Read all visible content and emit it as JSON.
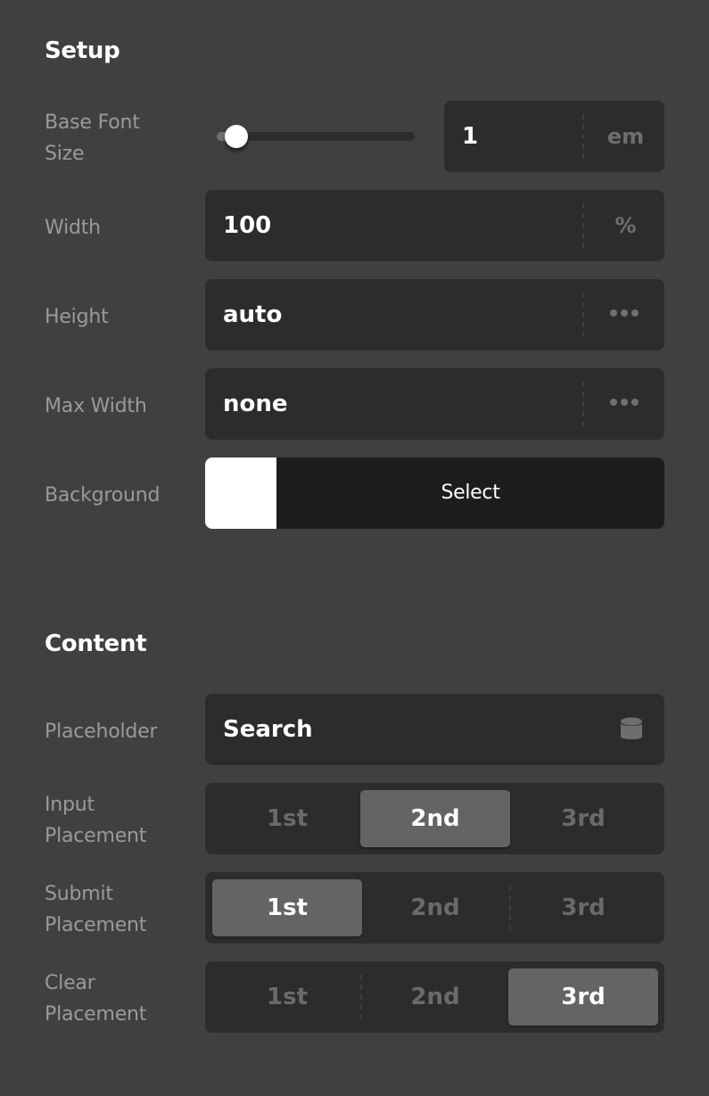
{
  "setup": {
    "title": "Setup",
    "base_font_size": {
      "label_line1": "Base Font",
      "label_line2": "Size",
      "slider_fraction": 0.1,
      "value": "1",
      "unit": "em"
    },
    "width": {
      "label": "Width",
      "value": "100",
      "unit": "%"
    },
    "height": {
      "label": "Height",
      "value": "auto",
      "unit_icon": "more-dots-icon"
    },
    "max_width": {
      "label": "Max Width",
      "value": "none",
      "unit_icon": "more-dots-icon"
    },
    "background": {
      "label": "Background",
      "swatch_color": "#ffffff",
      "select_label": "Select"
    }
  },
  "content": {
    "title": "Content",
    "placeholder": {
      "label": "Placeholder",
      "value": "Search",
      "icon": "database-icon"
    },
    "input_placement": {
      "label_line1": "Input",
      "label_line2": "Placement",
      "options": [
        "1st",
        "2nd",
        "3rd"
      ],
      "selected": "2nd"
    },
    "submit_placement": {
      "label_line1": "Submit",
      "label_line2": "Placement",
      "options": [
        "1st",
        "2nd",
        "3rd"
      ],
      "selected": "1st"
    },
    "clear_placement": {
      "label_line1": "Clear",
      "label_line2": "Placement",
      "options": [
        "1st",
        "2nd",
        "3rd"
      ],
      "selected": "3rd"
    }
  },
  "colors": {
    "panel_bg": "#404040",
    "field_bg": "#2c2c2c",
    "active_segment": "#646464",
    "label_text": "#9a9a9a",
    "muted_text": "#6e6e6e"
  }
}
